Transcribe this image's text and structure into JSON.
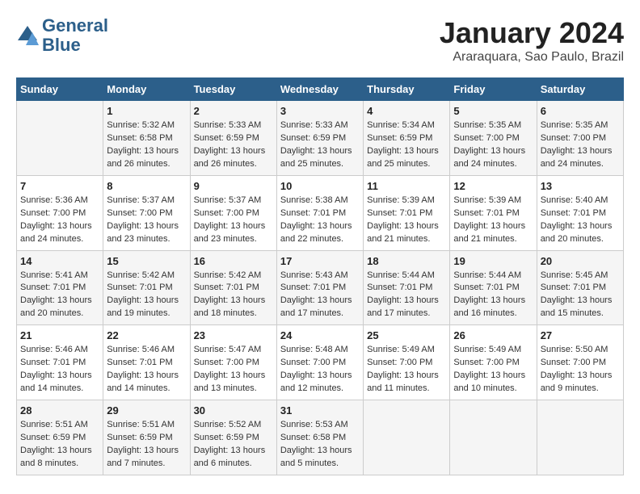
{
  "header": {
    "logo_line1": "General",
    "logo_line2": "Blue",
    "month": "January 2024",
    "location": "Araraquara, Sao Paulo, Brazil"
  },
  "days_of_week": [
    "Sunday",
    "Monday",
    "Tuesday",
    "Wednesday",
    "Thursday",
    "Friday",
    "Saturday"
  ],
  "weeks": [
    [
      {
        "day": "",
        "info": ""
      },
      {
        "day": "1",
        "info": "Sunrise: 5:32 AM\nSunset: 6:58 PM\nDaylight: 13 hours\nand 26 minutes."
      },
      {
        "day": "2",
        "info": "Sunrise: 5:33 AM\nSunset: 6:59 PM\nDaylight: 13 hours\nand 26 minutes."
      },
      {
        "day": "3",
        "info": "Sunrise: 5:33 AM\nSunset: 6:59 PM\nDaylight: 13 hours\nand 25 minutes."
      },
      {
        "day": "4",
        "info": "Sunrise: 5:34 AM\nSunset: 6:59 PM\nDaylight: 13 hours\nand 25 minutes."
      },
      {
        "day": "5",
        "info": "Sunrise: 5:35 AM\nSunset: 7:00 PM\nDaylight: 13 hours\nand 24 minutes."
      },
      {
        "day": "6",
        "info": "Sunrise: 5:35 AM\nSunset: 7:00 PM\nDaylight: 13 hours\nand 24 minutes."
      }
    ],
    [
      {
        "day": "7",
        "info": "Sunrise: 5:36 AM\nSunset: 7:00 PM\nDaylight: 13 hours\nand 24 minutes."
      },
      {
        "day": "8",
        "info": "Sunrise: 5:37 AM\nSunset: 7:00 PM\nDaylight: 13 hours\nand 23 minutes."
      },
      {
        "day": "9",
        "info": "Sunrise: 5:37 AM\nSunset: 7:00 PM\nDaylight: 13 hours\nand 23 minutes."
      },
      {
        "day": "10",
        "info": "Sunrise: 5:38 AM\nSunset: 7:01 PM\nDaylight: 13 hours\nand 22 minutes."
      },
      {
        "day": "11",
        "info": "Sunrise: 5:39 AM\nSunset: 7:01 PM\nDaylight: 13 hours\nand 21 minutes."
      },
      {
        "day": "12",
        "info": "Sunrise: 5:39 AM\nSunset: 7:01 PM\nDaylight: 13 hours\nand 21 minutes."
      },
      {
        "day": "13",
        "info": "Sunrise: 5:40 AM\nSunset: 7:01 PM\nDaylight: 13 hours\nand 20 minutes."
      }
    ],
    [
      {
        "day": "14",
        "info": "Sunrise: 5:41 AM\nSunset: 7:01 PM\nDaylight: 13 hours\nand 20 minutes."
      },
      {
        "day": "15",
        "info": "Sunrise: 5:42 AM\nSunset: 7:01 PM\nDaylight: 13 hours\nand 19 minutes."
      },
      {
        "day": "16",
        "info": "Sunrise: 5:42 AM\nSunset: 7:01 PM\nDaylight: 13 hours\nand 18 minutes."
      },
      {
        "day": "17",
        "info": "Sunrise: 5:43 AM\nSunset: 7:01 PM\nDaylight: 13 hours\nand 17 minutes."
      },
      {
        "day": "18",
        "info": "Sunrise: 5:44 AM\nSunset: 7:01 PM\nDaylight: 13 hours\nand 17 minutes."
      },
      {
        "day": "19",
        "info": "Sunrise: 5:44 AM\nSunset: 7:01 PM\nDaylight: 13 hours\nand 16 minutes."
      },
      {
        "day": "20",
        "info": "Sunrise: 5:45 AM\nSunset: 7:01 PM\nDaylight: 13 hours\nand 15 minutes."
      }
    ],
    [
      {
        "day": "21",
        "info": "Sunrise: 5:46 AM\nSunset: 7:01 PM\nDaylight: 13 hours\nand 14 minutes."
      },
      {
        "day": "22",
        "info": "Sunrise: 5:46 AM\nSunset: 7:01 PM\nDaylight: 13 hours\nand 14 minutes."
      },
      {
        "day": "23",
        "info": "Sunrise: 5:47 AM\nSunset: 7:00 PM\nDaylight: 13 hours\nand 13 minutes."
      },
      {
        "day": "24",
        "info": "Sunrise: 5:48 AM\nSunset: 7:00 PM\nDaylight: 13 hours\nand 12 minutes."
      },
      {
        "day": "25",
        "info": "Sunrise: 5:49 AM\nSunset: 7:00 PM\nDaylight: 13 hours\nand 11 minutes."
      },
      {
        "day": "26",
        "info": "Sunrise: 5:49 AM\nSunset: 7:00 PM\nDaylight: 13 hours\nand 10 minutes."
      },
      {
        "day": "27",
        "info": "Sunrise: 5:50 AM\nSunset: 7:00 PM\nDaylight: 13 hours\nand 9 minutes."
      }
    ],
    [
      {
        "day": "28",
        "info": "Sunrise: 5:51 AM\nSunset: 6:59 PM\nDaylight: 13 hours\nand 8 minutes."
      },
      {
        "day": "29",
        "info": "Sunrise: 5:51 AM\nSunset: 6:59 PM\nDaylight: 13 hours\nand 7 minutes."
      },
      {
        "day": "30",
        "info": "Sunrise: 5:52 AM\nSunset: 6:59 PM\nDaylight: 13 hours\nand 6 minutes."
      },
      {
        "day": "31",
        "info": "Sunrise: 5:53 AM\nSunset: 6:58 PM\nDaylight: 13 hours\nand 5 minutes."
      },
      {
        "day": "",
        "info": ""
      },
      {
        "day": "",
        "info": ""
      },
      {
        "day": "",
        "info": ""
      }
    ]
  ]
}
